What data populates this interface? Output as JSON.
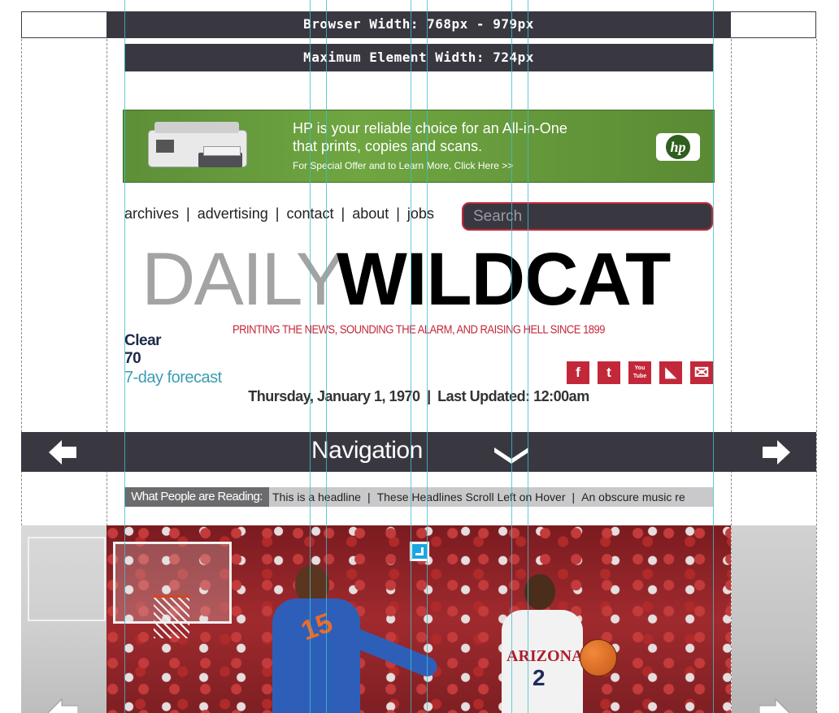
{
  "header": {
    "browser_width": "Browser Width: 768px - 979px",
    "max_element_width": "Maximum Element Width: 724px"
  },
  "ad": {
    "line1": "HP is your reliable choice for an All-in-One",
    "line2": "that prints, copies and scans.",
    "line3": "For Special Offer and to Learn More, Click Here >>",
    "brand": "hp"
  },
  "links": [
    "archives",
    "advertising",
    "contact",
    "about",
    "jobs"
  ],
  "search": {
    "placeholder": "Search"
  },
  "logo": {
    "part1": "DAILY",
    "part2": "WILDCAT"
  },
  "tagline": "PRINTING THE NEWS, SOUNDING THE ALARM, AND RAISING HELL SINCE 1899",
  "weather": {
    "condition": "Clear",
    "temp": "70",
    "forecast_link": "7-day forecast"
  },
  "date_line": {
    "date": "Thursday, January 1, 1970",
    "updated": "Last Updated: 12:00am"
  },
  "social": [
    {
      "name": "facebook-icon",
      "glyph": "f"
    },
    {
      "name": "twitter-icon",
      "glyph": "t"
    },
    {
      "name": "youtube-icon",
      "glyph": "You Tube"
    },
    {
      "name": "rss-icon",
      "glyph": "◣"
    },
    {
      "name": "email-icon",
      "glyph": "✉"
    }
  ],
  "navbar": {
    "title": "Navigation"
  },
  "reading": {
    "label": "What People are Reading:",
    "headlines": [
      "This is a headline",
      "These Headlines Scroll Left on Hover",
      "An obscure music re"
    ]
  },
  "colors": {
    "dark": "#393841",
    "accent_red": "#c3283a",
    "guide": "#3fbecb"
  }
}
